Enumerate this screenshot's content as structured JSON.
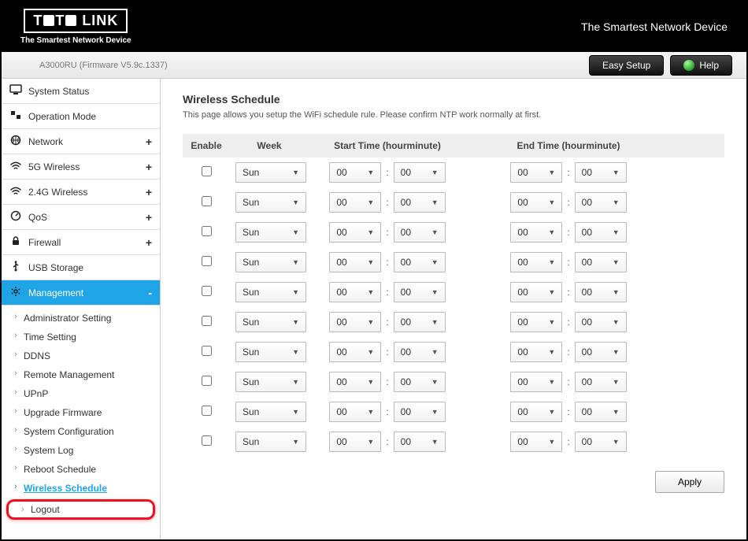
{
  "brand": {
    "name": "TOTO LINK",
    "tagline": "The Smartest Network Device"
  },
  "slogan": "The Smartest Network Device",
  "firmware": "A3000RU (Firmware V5.9c.1337)",
  "buttons": {
    "easy_setup": "Easy Setup",
    "help": "Help",
    "apply": "Apply"
  },
  "sidebar": {
    "items": [
      {
        "label": "System Status",
        "icon": "display-icon",
        "expandable": false
      },
      {
        "label": "Operation Mode",
        "icon": "mode-icon",
        "expandable": false
      },
      {
        "label": "Network",
        "icon": "globe-icon",
        "expandable": true,
        "expander": "+"
      },
      {
        "label": "5G Wireless",
        "icon": "wifi-icon",
        "expandable": true,
        "expander": "+"
      },
      {
        "label": "2.4G Wireless",
        "icon": "wifi-icon",
        "expandable": true,
        "expander": "+"
      },
      {
        "label": "QoS",
        "icon": "qos-icon",
        "expandable": true,
        "expander": "+"
      },
      {
        "label": "Firewall",
        "icon": "lock-icon",
        "expandable": true,
        "expander": "+"
      },
      {
        "label": "USB Storage",
        "icon": "usb-icon",
        "expandable": false
      },
      {
        "label": "Management",
        "icon": "gear-icon",
        "expandable": true,
        "expander": "-",
        "active": true
      }
    ],
    "management_sub": [
      {
        "label": "Administrator Setting"
      },
      {
        "label": "Time Setting"
      },
      {
        "label": "DDNS"
      },
      {
        "label": "Remote Management"
      },
      {
        "label": "UPnP"
      },
      {
        "label": "Upgrade Firmware"
      },
      {
        "label": "System Configuration"
      },
      {
        "label": "System Log"
      },
      {
        "label": "Reboot Schedule"
      },
      {
        "label": "Wireless Schedule",
        "current": true
      },
      {
        "label": "Logout",
        "highlight": true
      }
    ]
  },
  "page": {
    "title": "Wireless Schedule",
    "description": "This page allows you setup the WiFi schedule rule. Please confirm NTP work normally at first."
  },
  "table": {
    "headers": {
      "enable": "Enable",
      "week": "Week",
      "start": "Start Time (hourminute)",
      "end": "End Time (hourminute)"
    },
    "rows": [
      {
        "enabled": false,
        "week": "Sun",
        "start_h": "00",
        "start_m": "00",
        "end_h": "00",
        "end_m": "00"
      },
      {
        "enabled": false,
        "week": "Sun",
        "start_h": "00",
        "start_m": "00",
        "end_h": "00",
        "end_m": "00"
      },
      {
        "enabled": false,
        "week": "Sun",
        "start_h": "00",
        "start_m": "00",
        "end_h": "00",
        "end_m": "00"
      },
      {
        "enabled": false,
        "week": "Sun",
        "start_h": "00",
        "start_m": "00",
        "end_h": "00",
        "end_m": "00"
      },
      {
        "enabled": false,
        "week": "Sun",
        "start_h": "00",
        "start_m": "00",
        "end_h": "00",
        "end_m": "00"
      },
      {
        "enabled": false,
        "week": "Sun",
        "start_h": "00",
        "start_m": "00",
        "end_h": "00",
        "end_m": "00"
      },
      {
        "enabled": false,
        "week": "Sun",
        "start_h": "00",
        "start_m": "00",
        "end_h": "00",
        "end_m": "00"
      },
      {
        "enabled": false,
        "week": "Sun",
        "start_h": "00",
        "start_m": "00",
        "end_h": "00",
        "end_m": "00"
      },
      {
        "enabled": false,
        "week": "Sun",
        "start_h": "00",
        "start_m": "00",
        "end_h": "00",
        "end_m": "00"
      },
      {
        "enabled": false,
        "week": "Sun",
        "start_h": "00",
        "start_m": "00",
        "end_h": "00",
        "end_m": "00"
      }
    ]
  }
}
